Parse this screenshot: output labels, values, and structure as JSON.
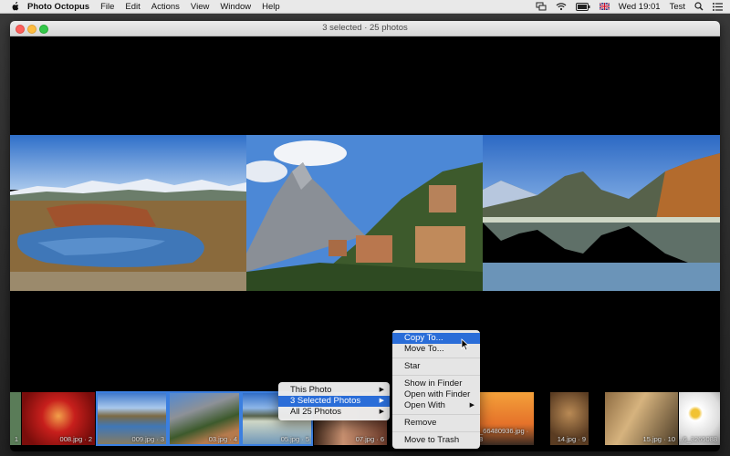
{
  "menubar": {
    "app_name": "Photo Octopus",
    "menus": [
      "File",
      "Edit",
      "Actions",
      "View",
      "Window",
      "Help"
    ],
    "clock": "Wed 19:01",
    "user": "Test"
  },
  "window": {
    "title": "3 selected · 25 photos"
  },
  "filmstrip": {
    "captions": [
      "1",
      "008.jpg · 2",
      "009.jpg · 3",
      "03.jpg · 4",
      "05.jpg · 5",
      "07.jpg · 6",
      "_66480936.jpg · 8",
      "14.jpg · 9",
      "15.jpg · 10",
      "...6_3265088"
    ]
  },
  "submenu": {
    "items": [
      "This Photo",
      "3 Selected Photos",
      "All 25 Photos"
    ]
  },
  "context_menu": {
    "copy_to": "Copy To...",
    "move_to": "Move To...",
    "star": "Star",
    "show_in_finder": "Show in Finder",
    "open_with_finder": "Open with Finder",
    "open_with": "Open With",
    "remove": "Remove",
    "move_to_trash": "Move to Trash"
  },
  "colors": {
    "selection_blue": "#2a6dd8",
    "thumb_selected_outline": "#3b7fe0"
  }
}
